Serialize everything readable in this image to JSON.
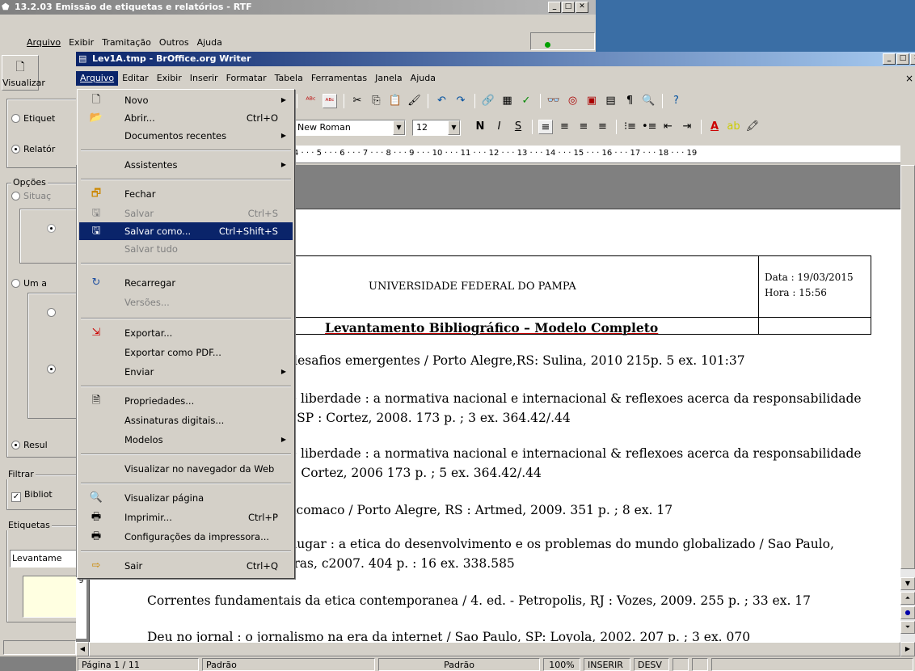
{
  "back_window": {
    "title": "13.2.03 Emissão de etiquetas e relatórios - RTF",
    "menu": [
      "Arquivo",
      "Exibir",
      "Tramitação",
      "Outros",
      "Ajuda"
    ],
    "toolbar_label": "Visualizar",
    "radio_etiquetas": "Etiquet",
    "radio_relatorio": "Relatór",
    "group_opcoes": "Opções",
    "radio_situacao": "Situaç",
    "radio_uma": "Um a",
    "radio_resultado": "Resul",
    "group_filtrar": "Filtrar",
    "check_biblio": "Bibliot",
    "group_etiquetas": "Etiquetas",
    "etiquetas_value": "Levantame"
  },
  "writer": {
    "title": "Lev1A.tmp - BrOffice.org Writer",
    "menu": [
      "Arquivo",
      "Editar",
      "Exibir",
      "Inserir",
      "Formatar",
      "Tabela",
      "Ferramentas",
      "Janela",
      "Ajuda"
    ],
    "font_name": "New Roman",
    "font_size": "12",
    "ruler_text": "4 · · · 5 · · · 6 · · · 7 · · · 8 · · · 9 · · · 10 · · · 11 · · · 12 · · · 13 · · · 14 · · · 15 · · · 16 · · · 17 · · · 18 · · · 19",
    "document": {
      "header_center": "UNIVERSIDADE FEDERAL DO PAMPA",
      "header_date": "Data : 19/03/2015",
      "header_time": "Hora : 15:56",
      "subtitle": "Levantamento Bibliográfico – Modelo Completo",
      "lines": [
        ": desafios emergentes /  Porto Alegre,RS: Sulina, 2010 215p. 5 ex. 101:37",
        "de liberdade : a normativa nacional e internacional & reflexoes acerca da responsabilidade",
        "o, SP : Cortez, 2008. 173 p. ; 3 ex. 364.42/.44",
        "de liberdade : a normativa nacional e internacional & reflexoes acerca da responsabilidade",
        "o : Cortez, 2006 173 p. ; 5 ex. 364.42/.44",
        "Nicomaco /  Porto Alegre, RS : Artmed, 2009. 351 p. ; 8 ex. 17",
        "o lugar : a etica do desenvolvimento e os problemas do mundo globalizado /  Sao Paulo,",
        "etras, c2007. 404 p. : 16 ex. 338.585",
        "Correntes fundamentais da etica contemporanea /  4. ed. - Petropolis, RJ : Vozes, 2009. 255 p. ; 33 ex. 17",
        "Deu no jornal : o jornalismo na era da internet /  Sao Paulo, SP: Loyola, 2002. 207 p. ; 3 ex. 070"
      ]
    },
    "status": {
      "page": "Página 1 / 11",
      "style": "Padrão",
      "lang": "Padrão",
      "zoom": "100%",
      "insert": "INSERIR",
      "sel": "DESV"
    }
  },
  "file_menu": {
    "items": [
      {
        "label": "Novo",
        "shortcut": "",
        "icon": "new-doc-icon"
      },
      {
        "label": "Abrir...",
        "shortcut": "Ctrl+O",
        "icon": "open-folder-icon"
      },
      {
        "label": "Documentos recentes",
        "shortcut": ""
      },
      {
        "label": "Assistentes",
        "shortcut": ""
      },
      {
        "label": "Fechar",
        "shortcut": "",
        "icon": "close-doc-icon"
      },
      {
        "label": "Salvar",
        "shortcut": "Ctrl+S",
        "icon": "save-icon"
      },
      {
        "label": "Salvar como...",
        "shortcut": "Ctrl+Shift+S",
        "icon": "save-as-icon"
      },
      {
        "label": "Salvar tudo",
        "shortcut": ""
      },
      {
        "label": "Recarregar",
        "shortcut": "",
        "icon": "reload-icon"
      },
      {
        "label": "Versões...",
        "shortcut": ""
      },
      {
        "label": "Exportar...",
        "shortcut": "",
        "icon": "export-icon"
      },
      {
        "label": "Exportar como PDF...",
        "shortcut": ""
      },
      {
        "label": "Enviar",
        "shortcut": ""
      },
      {
        "label": "Propriedades...",
        "shortcut": "",
        "icon": "properties-icon"
      },
      {
        "label": "Assinaturas digitais...",
        "shortcut": ""
      },
      {
        "label": "Modelos",
        "shortcut": ""
      },
      {
        "label": "Visualizar no navegador da Web",
        "shortcut": ""
      },
      {
        "label": "Visualizar página",
        "shortcut": "",
        "icon": "page-preview-icon"
      },
      {
        "label": "Imprimir...",
        "shortcut": "Ctrl+P",
        "icon": "print-icon"
      },
      {
        "label": "Configurações da impressora...",
        "shortcut": "",
        "icon": "printer-settings-icon"
      },
      {
        "label": "Sair",
        "shortcut": "Ctrl+Q",
        "icon": "exit-icon"
      }
    ]
  }
}
